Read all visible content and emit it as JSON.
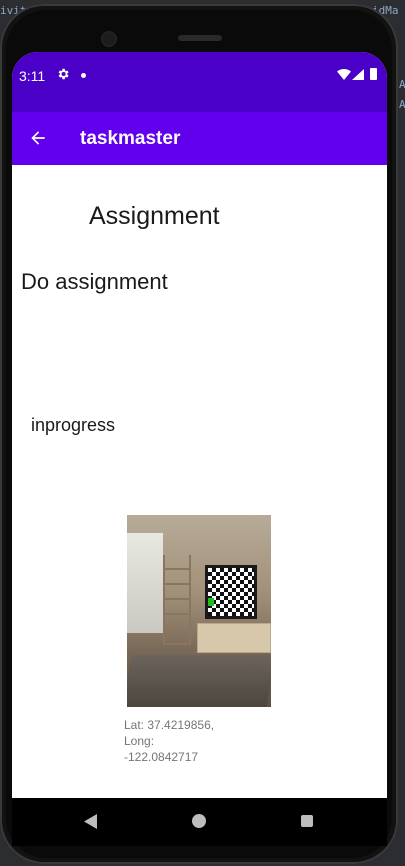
{
  "ide_background": {
    "snippets": [
      "ivit",
      "idMa",
      "A",
      "A"
    ]
  },
  "status_bar": {
    "time": "3:11",
    "icons": [
      "gear-icon",
      "dot-icon",
      "wifi-icon",
      "signal-icon",
      "battery-icon"
    ]
  },
  "app_bar": {
    "title": "taskmaster",
    "back_icon": "arrow-left-icon"
  },
  "content": {
    "heading": "Assignment",
    "task_title": "Do assignment",
    "task_state": "inprogress",
    "location_lines": [
      "Lat: 37.4219856,",
      "Long:",
      "-122.0842717"
    ]
  },
  "nav_bar": {
    "icons": [
      "back-triangle-icon",
      "home-circle-icon",
      "recents-square-icon"
    ]
  },
  "colors": {
    "status_bar": "#4b00c8",
    "app_bar": "#6200ee",
    "screen_bg": "#ffffff",
    "secondary_text": "#757575"
  }
}
